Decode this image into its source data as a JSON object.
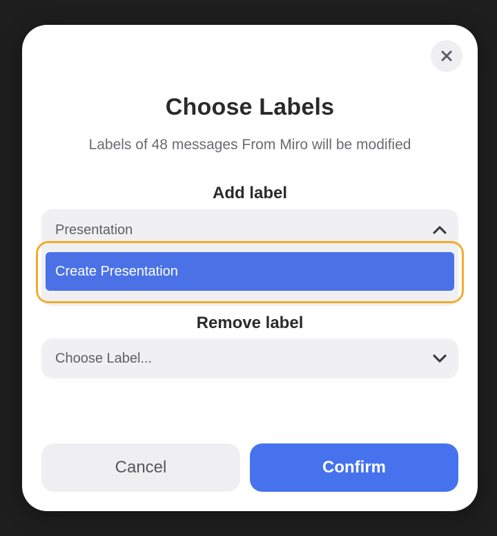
{
  "dialog": {
    "title": "Choose Labels",
    "subtitle": "Labels of 48 messages From Miro will be modified",
    "close_icon": "close-icon"
  },
  "add_label": {
    "heading": "Add label",
    "input_value": "Presentation",
    "toggle_icon": "chevron-up-icon",
    "options": [
      {
        "label": "Create Presentation",
        "highlighted": true
      }
    ]
  },
  "remove_label": {
    "heading": "Remove label",
    "placeholder": "Choose Label...",
    "toggle_icon": "chevron-down-icon"
  },
  "actions": {
    "cancel_label": "Cancel",
    "confirm_label": "Confirm"
  },
  "colors": {
    "accent": "#4672ee",
    "option_highlight": "#4a72e6",
    "focus_ring": "#f2ac2b"
  }
}
